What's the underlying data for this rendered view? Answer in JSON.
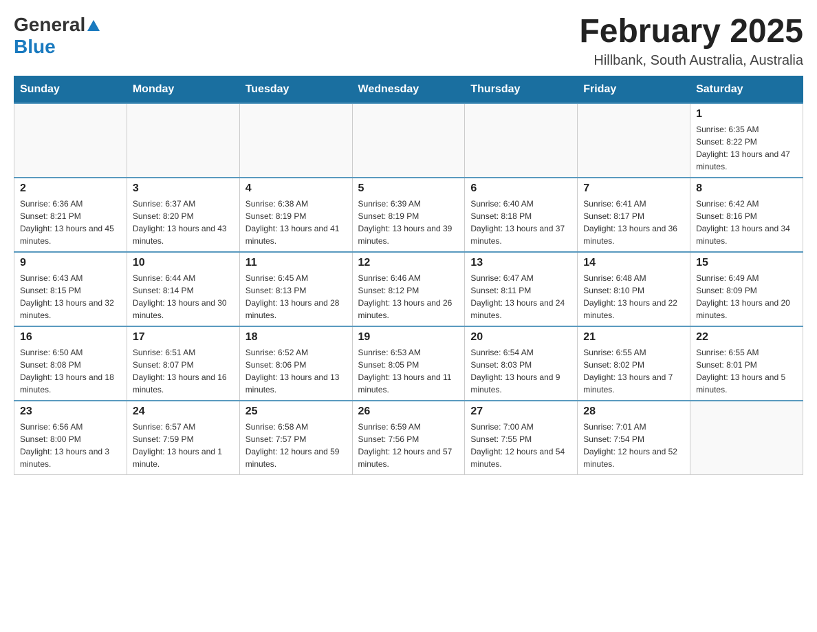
{
  "logo": {
    "general": "General",
    "blue": "Blue"
  },
  "title": "February 2025",
  "location": "Hillbank, South Australia, Australia",
  "days_of_week": [
    "Sunday",
    "Monday",
    "Tuesday",
    "Wednesday",
    "Thursday",
    "Friday",
    "Saturday"
  ],
  "weeks": [
    [
      {
        "day": "",
        "info": ""
      },
      {
        "day": "",
        "info": ""
      },
      {
        "day": "",
        "info": ""
      },
      {
        "day": "",
        "info": ""
      },
      {
        "day": "",
        "info": ""
      },
      {
        "day": "",
        "info": ""
      },
      {
        "day": "1",
        "info": "Sunrise: 6:35 AM\nSunset: 8:22 PM\nDaylight: 13 hours and 47 minutes."
      }
    ],
    [
      {
        "day": "2",
        "info": "Sunrise: 6:36 AM\nSunset: 8:21 PM\nDaylight: 13 hours and 45 minutes."
      },
      {
        "day": "3",
        "info": "Sunrise: 6:37 AM\nSunset: 8:20 PM\nDaylight: 13 hours and 43 minutes."
      },
      {
        "day": "4",
        "info": "Sunrise: 6:38 AM\nSunset: 8:19 PM\nDaylight: 13 hours and 41 minutes."
      },
      {
        "day": "5",
        "info": "Sunrise: 6:39 AM\nSunset: 8:19 PM\nDaylight: 13 hours and 39 minutes."
      },
      {
        "day": "6",
        "info": "Sunrise: 6:40 AM\nSunset: 8:18 PM\nDaylight: 13 hours and 37 minutes."
      },
      {
        "day": "7",
        "info": "Sunrise: 6:41 AM\nSunset: 8:17 PM\nDaylight: 13 hours and 36 minutes."
      },
      {
        "day": "8",
        "info": "Sunrise: 6:42 AM\nSunset: 8:16 PM\nDaylight: 13 hours and 34 minutes."
      }
    ],
    [
      {
        "day": "9",
        "info": "Sunrise: 6:43 AM\nSunset: 8:15 PM\nDaylight: 13 hours and 32 minutes."
      },
      {
        "day": "10",
        "info": "Sunrise: 6:44 AM\nSunset: 8:14 PM\nDaylight: 13 hours and 30 minutes."
      },
      {
        "day": "11",
        "info": "Sunrise: 6:45 AM\nSunset: 8:13 PM\nDaylight: 13 hours and 28 minutes."
      },
      {
        "day": "12",
        "info": "Sunrise: 6:46 AM\nSunset: 8:12 PM\nDaylight: 13 hours and 26 minutes."
      },
      {
        "day": "13",
        "info": "Sunrise: 6:47 AM\nSunset: 8:11 PM\nDaylight: 13 hours and 24 minutes."
      },
      {
        "day": "14",
        "info": "Sunrise: 6:48 AM\nSunset: 8:10 PM\nDaylight: 13 hours and 22 minutes."
      },
      {
        "day": "15",
        "info": "Sunrise: 6:49 AM\nSunset: 8:09 PM\nDaylight: 13 hours and 20 minutes."
      }
    ],
    [
      {
        "day": "16",
        "info": "Sunrise: 6:50 AM\nSunset: 8:08 PM\nDaylight: 13 hours and 18 minutes."
      },
      {
        "day": "17",
        "info": "Sunrise: 6:51 AM\nSunset: 8:07 PM\nDaylight: 13 hours and 16 minutes."
      },
      {
        "day": "18",
        "info": "Sunrise: 6:52 AM\nSunset: 8:06 PM\nDaylight: 13 hours and 13 minutes."
      },
      {
        "day": "19",
        "info": "Sunrise: 6:53 AM\nSunset: 8:05 PM\nDaylight: 13 hours and 11 minutes."
      },
      {
        "day": "20",
        "info": "Sunrise: 6:54 AM\nSunset: 8:03 PM\nDaylight: 13 hours and 9 minutes."
      },
      {
        "day": "21",
        "info": "Sunrise: 6:55 AM\nSunset: 8:02 PM\nDaylight: 13 hours and 7 minutes."
      },
      {
        "day": "22",
        "info": "Sunrise: 6:55 AM\nSunset: 8:01 PM\nDaylight: 13 hours and 5 minutes."
      }
    ],
    [
      {
        "day": "23",
        "info": "Sunrise: 6:56 AM\nSunset: 8:00 PM\nDaylight: 13 hours and 3 minutes."
      },
      {
        "day": "24",
        "info": "Sunrise: 6:57 AM\nSunset: 7:59 PM\nDaylight: 13 hours and 1 minute."
      },
      {
        "day": "25",
        "info": "Sunrise: 6:58 AM\nSunset: 7:57 PM\nDaylight: 12 hours and 59 minutes."
      },
      {
        "day": "26",
        "info": "Sunrise: 6:59 AM\nSunset: 7:56 PM\nDaylight: 12 hours and 57 minutes."
      },
      {
        "day": "27",
        "info": "Sunrise: 7:00 AM\nSunset: 7:55 PM\nDaylight: 12 hours and 54 minutes."
      },
      {
        "day": "28",
        "info": "Sunrise: 7:01 AM\nSunset: 7:54 PM\nDaylight: 12 hours and 52 minutes."
      },
      {
        "day": "",
        "info": ""
      }
    ]
  ]
}
